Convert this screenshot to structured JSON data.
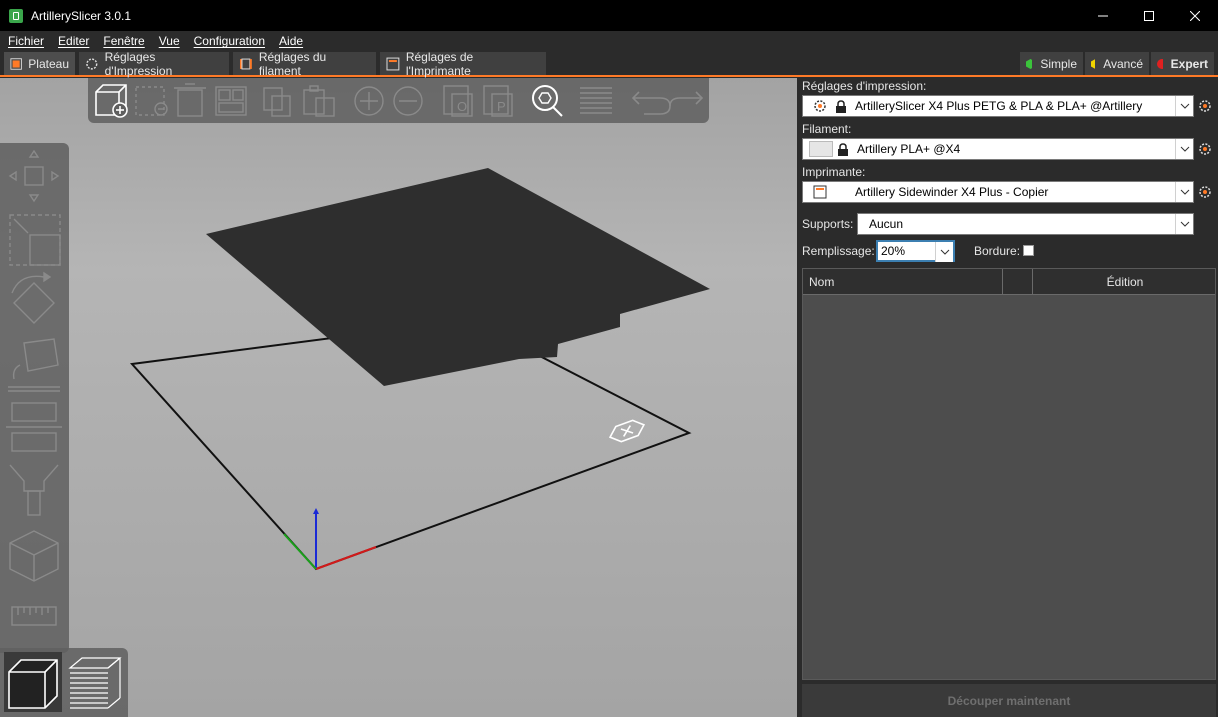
{
  "window": {
    "title": "ArtillerySlicer 3.0.1"
  },
  "menu": [
    "Fichier",
    "Editer",
    "Fenêtre",
    "Vue",
    "Configuration",
    "Aide"
  ],
  "tabs": [
    {
      "label": "Plateau",
      "active": true
    },
    {
      "label": "Réglages d'Impression"
    },
    {
      "label": "Réglages du filament"
    },
    {
      "label": "Réglages de l'Imprimante"
    }
  ],
  "modes": [
    {
      "label": "Simple",
      "color": "#3bc43b"
    },
    {
      "label": "Avancé",
      "color": "#f0d400"
    },
    {
      "label": "Expert",
      "color": "#e02020",
      "active": true
    }
  ],
  "panel": {
    "print_label": "Réglages d'impression:",
    "print_value": "ArtillerySlicer X4 Plus PETG & PLA & PLA+ @Artillery",
    "filament_label": "Filament:",
    "filament_value": "Artillery PLA+ @X4",
    "printer_label": "Imprimante:",
    "printer_value": "Artillery Sidewinder X4 Plus - Copier",
    "supports_label": "Supports:",
    "supports_value": "Aucun",
    "infill_label": "Remplissage:",
    "infill_value": "20%",
    "brim_label": "Bordure:",
    "brim_checked": false,
    "table_headers": {
      "name": "Nom",
      "edit": "Édition"
    },
    "slice_button": "Découper maintenant"
  },
  "colors": {
    "accent": "#ff7a27",
    "background": "#2b2b2b",
    "bed": "#2e2e2e"
  }
}
